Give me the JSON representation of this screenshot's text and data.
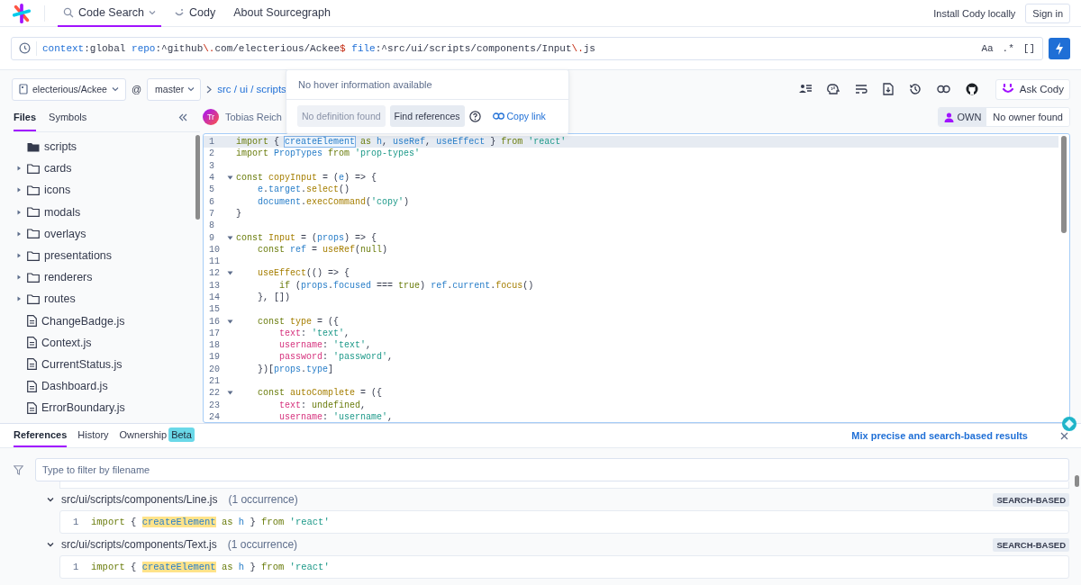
{
  "nav": {
    "items": [
      {
        "label": "Code Search",
        "kind": "search",
        "selected": true
      },
      {
        "label": "Cody",
        "kind": "cody",
        "selected": false
      },
      {
        "label": "About Sourcegraph",
        "kind": "plain",
        "selected": false
      }
    ],
    "actions": [
      {
        "label": "Install Cody locally",
        "kind": "link"
      },
      {
        "label": "Sign in",
        "kind": "button"
      }
    ]
  },
  "search": {
    "query": [
      {
        "text": "context",
        "kind": "key"
      },
      {
        "text": ":global",
        "kind": "text"
      },
      {
        "text": " repo",
        "kind": "key"
      },
      {
        "text": ":^github",
        "kind": "text"
      },
      {
        "text": "\\.",
        "kind": "escape"
      },
      {
        "text": "com/electerious/Ackee",
        "kind": "text"
      },
      {
        "text": "$",
        "kind": "escape"
      },
      {
        "text": " file",
        "kind": "key"
      },
      {
        "text": ":^src/ui/scripts/components/Input",
        "kind": "text"
      },
      {
        "text": "\\.",
        "kind": "escape"
      },
      {
        "text": "js",
        "kind": "text"
      }
    ],
    "toggles": [
      "Aa",
      ".*",
      "[]"
    ]
  },
  "repo_bar": {
    "repo": "electerious/Ackee",
    "at": "@",
    "branch": "master",
    "path": "src / ui / scripts",
    "ask_cody": "Ask Cody"
  },
  "popover": {
    "message": "No hover information available",
    "buttons": [
      {
        "label": "No definition found",
        "disabled": true
      },
      {
        "label": "Find references",
        "disabled": false
      }
    ],
    "copy_link": "Copy link"
  },
  "sidebar": {
    "tabs": [
      {
        "label": "Files",
        "selected": true
      },
      {
        "label": "Symbols",
        "selected": false
      }
    ],
    "tree": [
      {
        "name": "scripts",
        "kind": "current"
      },
      {
        "name": "cards",
        "kind": "folder",
        "expanded": false
      },
      {
        "name": "icons",
        "kind": "folder",
        "expanded": false
      },
      {
        "name": "modals",
        "kind": "folder",
        "expanded": false
      },
      {
        "name": "overlays",
        "kind": "folder",
        "expanded": false
      },
      {
        "name": "presentations",
        "kind": "folder",
        "expanded": false
      },
      {
        "name": "renderers",
        "kind": "folder",
        "expanded": false
      },
      {
        "name": "routes",
        "kind": "folder",
        "expanded": false
      },
      {
        "name": "ChangeBadge.js",
        "kind": "file"
      },
      {
        "name": "Context.js",
        "kind": "file"
      },
      {
        "name": "CurrentStatus.js",
        "kind": "file"
      },
      {
        "name": "Dashboard.js",
        "kind": "file"
      },
      {
        "name": "ErrorBoundary.js",
        "kind": "file"
      }
    ]
  },
  "file_header": {
    "initials": "Tr",
    "author": "Tobias Reich",
    "own": "OWN",
    "owner": "No owner found"
  },
  "code": {
    "lines": [
      {
        "number": "1",
        "foldable": false,
        "highlighted": true,
        "tokens": [
          {
            "text": "import",
            "kind": "keyword"
          },
          {
            "text": " { ",
            "kind": "plain"
          },
          {
            "text": "createElement",
            "kind": "hover"
          },
          {
            "text": " as",
            "kind": "keyword"
          },
          {
            "text": " h",
            "kind": "variable"
          },
          {
            "text": ", ",
            "kind": "plain"
          },
          {
            "text": "useRef",
            "kind": "variable"
          },
          {
            "text": ", ",
            "kind": "plain"
          },
          {
            "text": "useEffect",
            "kind": "variable"
          },
          {
            "text": " } ",
            "kind": "plain"
          },
          {
            "text": "from",
            "kind": "keyword"
          },
          {
            "text": " 'react'",
            "kind": "string"
          }
        ]
      },
      {
        "number": "2",
        "foldable": false,
        "highlighted": false,
        "tokens": [
          {
            "text": "import",
            "kind": "keyword"
          },
          {
            "text": " PropTypes",
            "kind": "variable"
          },
          {
            "text": " from",
            "kind": "keyword"
          },
          {
            "text": " 'prop-types'",
            "kind": "string"
          }
        ]
      },
      {
        "number": "3",
        "foldable": false,
        "highlighted": false
      },
      {
        "number": "4",
        "foldable": true,
        "highlighted": false,
        "tokens": [
          {
            "text": "const",
            "kind": "keyword"
          },
          {
            "text": " copyInput",
            "kind": "function"
          },
          {
            "text": " = (",
            "kind": "plain"
          },
          {
            "text": "e",
            "kind": "variable"
          },
          {
            "text": ") => {",
            "kind": "plain"
          }
        ]
      },
      {
        "number": "5",
        "foldable": false,
        "highlighted": false,
        "tokens": [
          {
            "text": "    e",
            "kind": "variable"
          },
          {
            "text": ".",
            "kind": "plain"
          },
          {
            "text": "target",
            "kind": "variable"
          },
          {
            "text": ".",
            "kind": "plain"
          },
          {
            "text": "select",
            "kind": "function"
          },
          {
            "text": "()",
            "kind": "plain"
          }
        ]
      },
      {
        "number": "6",
        "foldable": false,
        "highlighted": false,
        "tokens": [
          {
            "text": "    document",
            "kind": "variable"
          },
          {
            "text": ".",
            "kind": "plain"
          },
          {
            "text": "execCommand",
            "kind": "function"
          },
          {
            "text": "(",
            "kind": "plain"
          },
          {
            "text": "'copy'",
            "kind": "string"
          },
          {
            "text": ")",
            "kind": "plain"
          }
        ]
      },
      {
        "number": "7",
        "foldable": false,
        "highlighted": false,
        "tokens": [
          {
            "text": "}",
            "kind": "plain"
          }
        ]
      },
      {
        "number": "8",
        "foldable": false,
        "highlighted": false
      },
      {
        "number": "9",
        "foldable": true,
        "highlighted": false,
        "tokens": [
          {
            "text": "const",
            "kind": "keyword"
          },
          {
            "text": " Input",
            "kind": "function"
          },
          {
            "text": " = (",
            "kind": "plain"
          },
          {
            "text": "props",
            "kind": "variable"
          },
          {
            "text": ") => {",
            "kind": "plain"
          }
        ]
      },
      {
        "number": "10",
        "foldable": false,
        "highlighted": false,
        "tokens": [
          {
            "text": "    const",
            "kind": "keyword"
          },
          {
            "text": " ref",
            "kind": "variable"
          },
          {
            "text": " = ",
            "kind": "plain"
          },
          {
            "text": "useRef",
            "kind": "function"
          },
          {
            "text": "(",
            "kind": "plain"
          },
          {
            "text": "null",
            "kind": "keyword"
          },
          {
            "text": ")",
            "kind": "plain"
          }
        ]
      },
      {
        "number": "11",
        "foldable": false,
        "highlighted": false
      },
      {
        "number": "12",
        "foldable": true,
        "highlighted": false,
        "tokens": [
          {
            "text": "    useEffect",
            "kind": "function"
          },
          {
            "text": "(() => {",
            "kind": "plain"
          }
        ]
      },
      {
        "number": "13",
        "foldable": false,
        "highlighted": false,
        "tokens": [
          {
            "text": "        if",
            "kind": "keyword"
          },
          {
            "text": " (",
            "kind": "plain"
          },
          {
            "text": "props",
            "kind": "variable"
          },
          {
            "text": ".",
            "kind": "plain"
          },
          {
            "text": "focused",
            "kind": "variable"
          },
          {
            "text": " === ",
            "kind": "plain"
          },
          {
            "text": "true",
            "kind": "keyword"
          },
          {
            "text": ") ",
            "kind": "plain"
          },
          {
            "text": "ref",
            "kind": "variable"
          },
          {
            "text": ".",
            "kind": "plain"
          },
          {
            "text": "current",
            "kind": "variable"
          },
          {
            "text": ".",
            "kind": "plain"
          },
          {
            "text": "focus",
            "kind": "function"
          },
          {
            "text": "()",
            "kind": "plain"
          }
        ]
      },
      {
        "number": "14",
        "foldable": false,
        "highlighted": false,
        "tokens": [
          {
            "text": "    }, [])",
            "kind": "plain"
          }
        ]
      },
      {
        "number": "15",
        "foldable": false,
        "highlighted": false
      },
      {
        "number": "16",
        "foldable": true,
        "highlighted": false,
        "tokens": [
          {
            "text": "    const",
            "kind": "keyword"
          },
          {
            "text": " type",
            "kind": "function"
          },
          {
            "text": " = ({",
            "kind": "plain"
          }
        ]
      },
      {
        "number": "17",
        "foldable": false,
        "highlighted": false,
        "tokens": [
          {
            "text": "        text",
            "kind": "property"
          },
          {
            "text": ": ",
            "kind": "plain"
          },
          {
            "text": "'text'",
            "kind": "string"
          },
          {
            "text": ",",
            "kind": "plain"
          }
        ]
      },
      {
        "number": "18",
        "foldable": false,
        "highlighted": false,
        "tokens": [
          {
            "text": "        username",
            "kind": "property"
          },
          {
            "text": ": ",
            "kind": "plain"
          },
          {
            "text": "'text'",
            "kind": "string"
          },
          {
            "text": ",",
            "kind": "plain"
          }
        ]
      },
      {
        "number": "19",
        "foldable": false,
        "highlighted": false,
        "tokens": [
          {
            "text": "        password",
            "kind": "property"
          },
          {
            "text": ": ",
            "kind": "plain"
          },
          {
            "text": "'password'",
            "kind": "string"
          },
          {
            "text": ",",
            "kind": "plain"
          }
        ]
      },
      {
        "number": "20",
        "foldable": false,
        "highlighted": false,
        "tokens": [
          {
            "text": "    })[",
            "kind": "plain"
          },
          {
            "text": "props",
            "kind": "variable"
          },
          {
            "text": ".",
            "kind": "plain"
          },
          {
            "text": "type",
            "kind": "variable"
          },
          {
            "text": "]",
            "kind": "plain"
          }
        ]
      },
      {
        "number": "21",
        "foldable": false,
        "highlighted": false
      },
      {
        "number": "22",
        "foldable": true,
        "highlighted": false,
        "tokens": [
          {
            "text": "    const",
            "kind": "keyword"
          },
          {
            "text": " autoComplete",
            "kind": "function"
          },
          {
            "text": " = ({",
            "kind": "plain"
          }
        ]
      },
      {
        "number": "23",
        "foldable": false,
        "highlighted": false,
        "tokens": [
          {
            "text": "        text",
            "kind": "property"
          },
          {
            "text": ": ",
            "kind": "plain"
          },
          {
            "text": "undefined",
            "kind": "keyword"
          },
          {
            "text": ",",
            "kind": "plain"
          }
        ]
      },
      {
        "number": "24",
        "foldable": false,
        "highlighted": false,
        "tokens": [
          {
            "text": "        username",
            "kind": "property"
          },
          {
            "text": ": ",
            "kind": "plain"
          },
          {
            "text": "'username'",
            "kind": "string"
          },
          {
            "text": ",",
            "kind": "plain"
          }
        ]
      }
    ]
  },
  "references": {
    "tabs": [
      {
        "label": "References",
        "selected": true
      },
      {
        "label": "History",
        "selected": false
      },
      {
        "label": "Ownership",
        "selected": false,
        "badge": "Beta"
      }
    ],
    "mix_link": "Mix precise and search-based results",
    "filter_placeholder": "Type to filter by filename",
    "groups": [
      {
        "path": "src/ui/scripts/components/Line.js",
        "count": "(1 occurrence)",
        "tag": "SEARCH-BASED",
        "expanded": true,
        "matches": [
          {
            "number": "1",
            "tokens": [
              {
                "text": "import",
                "kind": "keyword"
              },
              {
                "text": " { ",
                "kind": "plain"
              },
              {
                "text": "createElement",
                "kind": "match"
              },
              {
                "text": " as",
                "kind": "keyword"
              },
              {
                "text": " h",
                "kind": "variable"
              },
              {
                "text": " } ",
                "kind": "plain"
              },
              {
                "text": "from",
                "kind": "keyword"
              },
              {
                "text": " 'react'",
                "kind": "string"
              }
            ]
          }
        ]
      },
      {
        "path": "src/ui/scripts/components/Text.js",
        "count": "(1 occurrence)",
        "tag": "SEARCH-BASED",
        "expanded": true,
        "matches": [
          {
            "number": "1",
            "tokens": [
              {
                "text": "import",
                "kind": "keyword"
              },
              {
                "text": " { ",
                "kind": "plain"
              },
              {
                "text": "createElement",
                "kind": "match"
              },
              {
                "text": " as",
                "kind": "keyword"
              },
              {
                "text": " h",
                "kind": "variable"
              },
              {
                "text": " } ",
                "kind": "plain"
              },
              {
                "text": "from",
                "kind": "keyword"
              },
              {
                "text": " 'react'",
                "kind": "string"
              }
            ]
          }
        ]
      }
    ]
  }
}
